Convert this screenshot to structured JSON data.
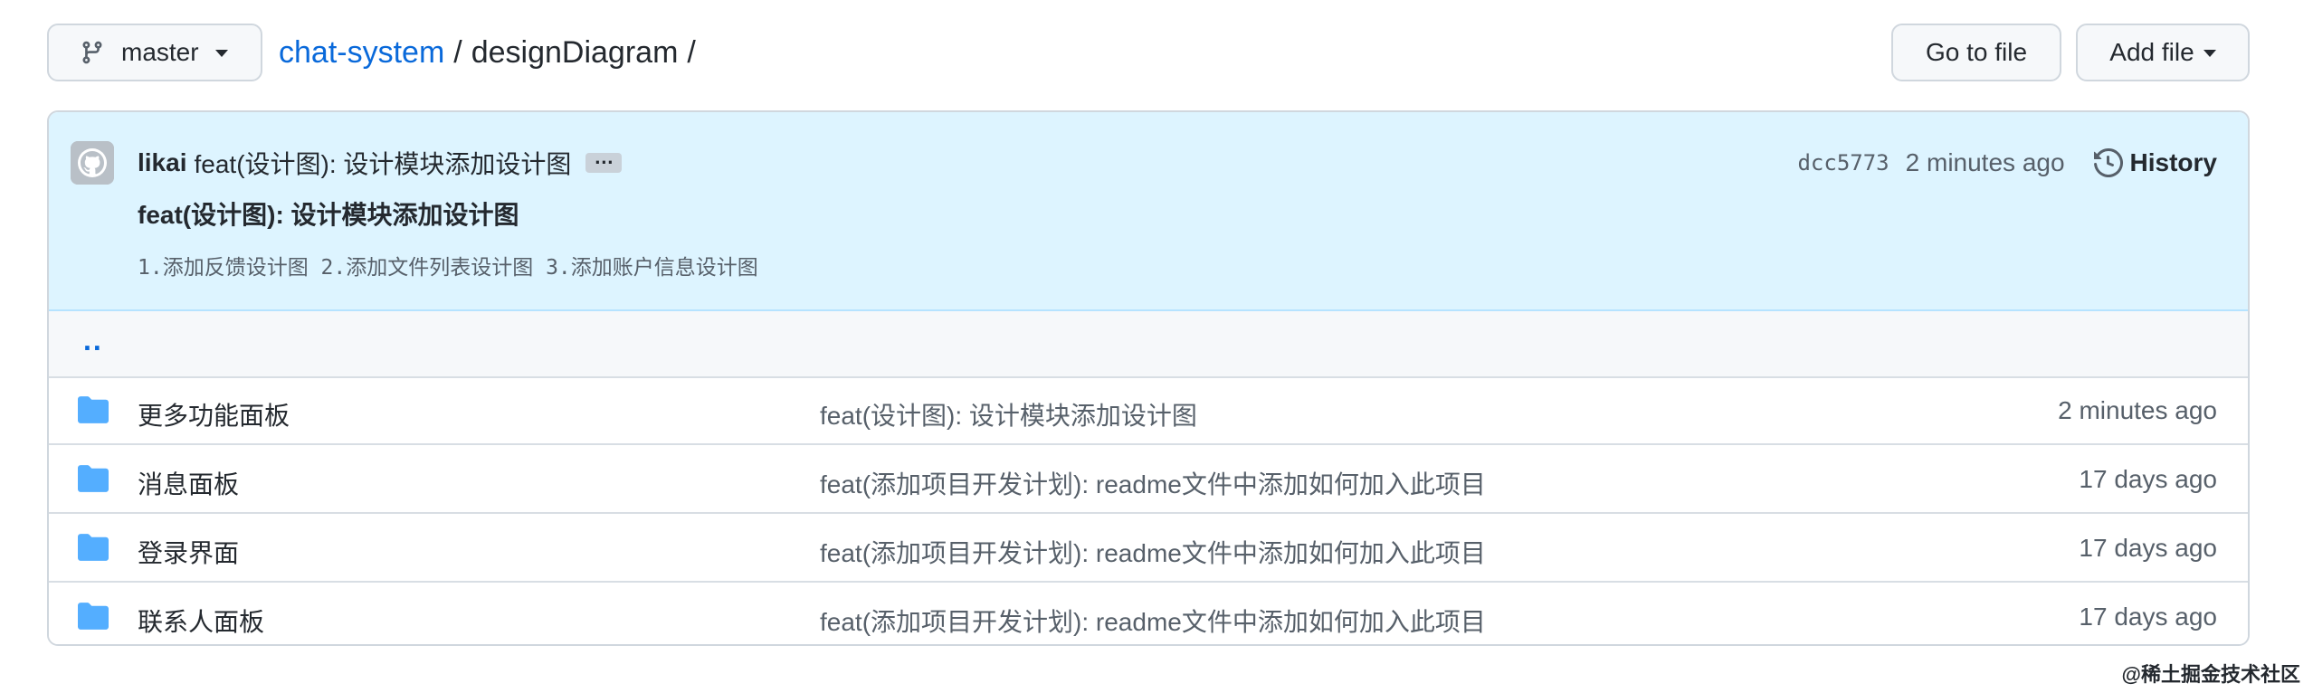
{
  "topbar": {
    "branch": "master",
    "repo": "chat-system",
    "separator": "/",
    "directory": "designDiagram",
    "trailing_separator": "/",
    "go_to_file": "Go to file",
    "add_file": "Add file"
  },
  "commit": {
    "author": "likai",
    "message": "feat(设计图): 设计模块添加设计图",
    "ellipsis": "…",
    "title": "feat(设计图): 设计模块添加设计图",
    "body": "1.添加反馈设计图 2.添加文件列表设计图 3.添加账户信息设计图",
    "sha": "dcc5773",
    "time": "2 minutes ago",
    "history_label": "History"
  },
  "parent_link": "..",
  "files": [
    {
      "name": "更多功能面板",
      "commit": "feat(设计图): 设计模块添加设计图",
      "age": "2 minutes ago",
      "icon": "folder-icon"
    },
    {
      "name": "消息面板",
      "commit": "feat(添加项目开发计划): readme文件中添加如何加入此项目",
      "age": "17 days ago",
      "icon": "folder-icon"
    },
    {
      "name": "登录界面",
      "commit": "feat(添加项目开发计划): readme文件中添加如何加入此项目",
      "age": "17 days ago",
      "icon": "folder-icon"
    },
    {
      "name": "联系人面板",
      "commit": "feat(添加项目开发计划): readme文件中添加如何加入此项目",
      "age": "17 days ago",
      "icon": "folder-icon"
    }
  ],
  "watermark": "@稀土掘金技术社区",
  "colors": {
    "link": "#0969da",
    "header_bg": "#ddf4ff",
    "folder": "#54aeff"
  }
}
